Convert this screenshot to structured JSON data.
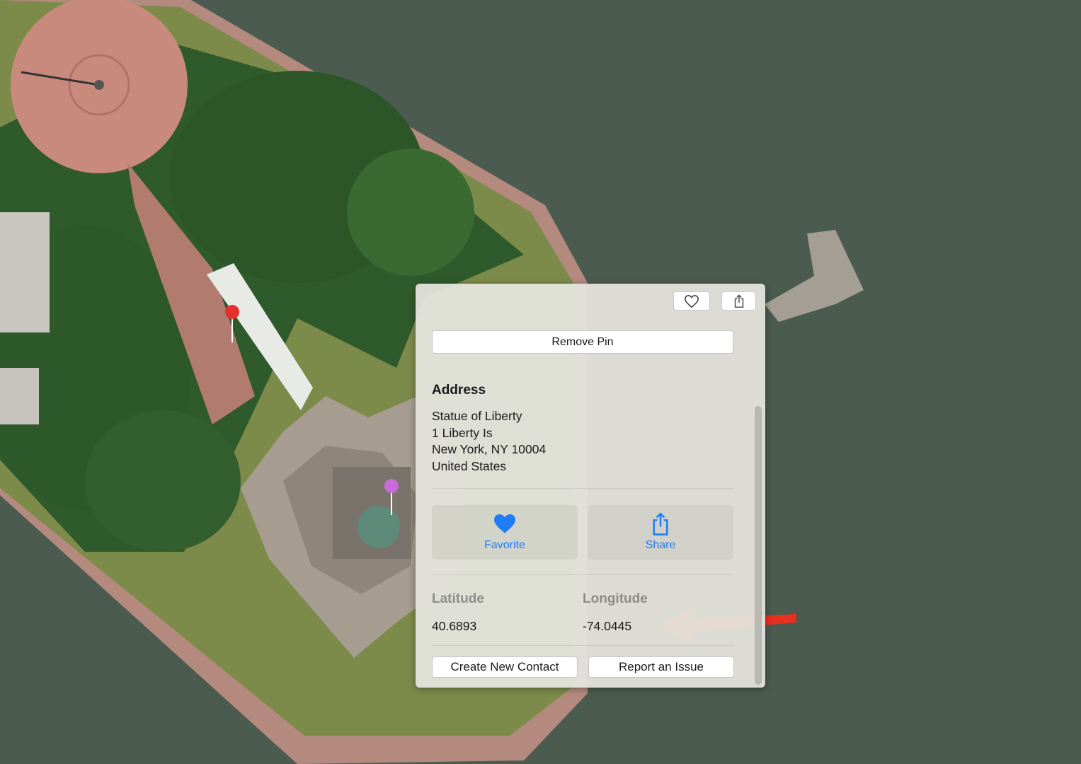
{
  "map": {
    "view": "satellite",
    "annotation": "red-arrow-pointing-at-longitude"
  },
  "popover": {
    "favorite_icon": "heart-outline-icon",
    "share_icon": "share-icon",
    "remove_pin_label": "Remove Pin",
    "address": {
      "title": "Address",
      "lines": [
        "Statue of Liberty",
        "1 Liberty Is",
        "New York, NY  10004",
        "United States"
      ]
    },
    "actions": {
      "favorite_label": "Favorite",
      "share_label": "Share"
    },
    "coordinates": {
      "latitude_label": "Latitude",
      "latitude_value": "40.6893",
      "longitude_label": "Longitude",
      "longitude_value": "-74.0445"
    },
    "create_contact_label": "Create New Contact",
    "report_issue_label": "Report an Issue"
  },
  "colors": {
    "water": "#4a5a4f",
    "accent": "#1f7cf5",
    "arrow": "#e8301f",
    "pin_red": "#e53030",
    "pin_purple": "#c66bd9"
  }
}
